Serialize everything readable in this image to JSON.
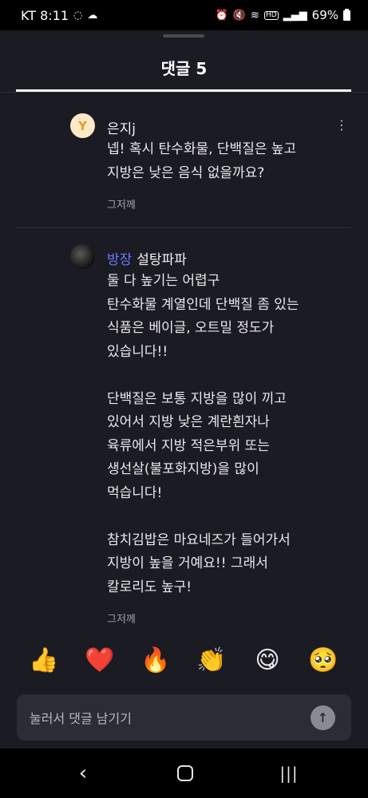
{
  "status_bar": {
    "carrier_time": "KT 8:11",
    "battery": "69%"
  },
  "sheet": {
    "title": "댓글 5"
  },
  "comments": [
    {
      "avatar_letter": "Y",
      "author": "은지j",
      "badge": "",
      "lines": [
        "넵! 혹시 탄수화물, 단백질은 높고",
        "지방은 낮은 음식 없을까요?"
      ],
      "time": "그저께"
    },
    {
      "avatar_letter": "",
      "author": "설탕파파",
      "badge": "방장",
      "lines": [
        "둘 다 높기는 어렵구",
        "탄수화물 계열인데 단백질 좀 있는",
        "식품은 베이글, 오트밀 정도가",
        "있습니다!!",
        "",
        "단백질은 보통 지방을 많이 끼고",
        "있어서 지방 낮은 계란흰자나",
        "육류에서 지방 적은부위 또는",
        "생선살(불포화지방)을 많이",
        "먹습니다!",
        "",
        "참치김밥은 마요네즈가 들어가서",
        "지방이 높을 거예요!! 그래서",
        "칼로리도 높구!"
      ],
      "time": "그저께"
    }
  ],
  "reactions": [
    "👍",
    "❤️",
    "🔥",
    "👏",
    "😋",
    "🥺"
  ],
  "input": {
    "placeholder": "눌러서 댓글 남기기"
  }
}
